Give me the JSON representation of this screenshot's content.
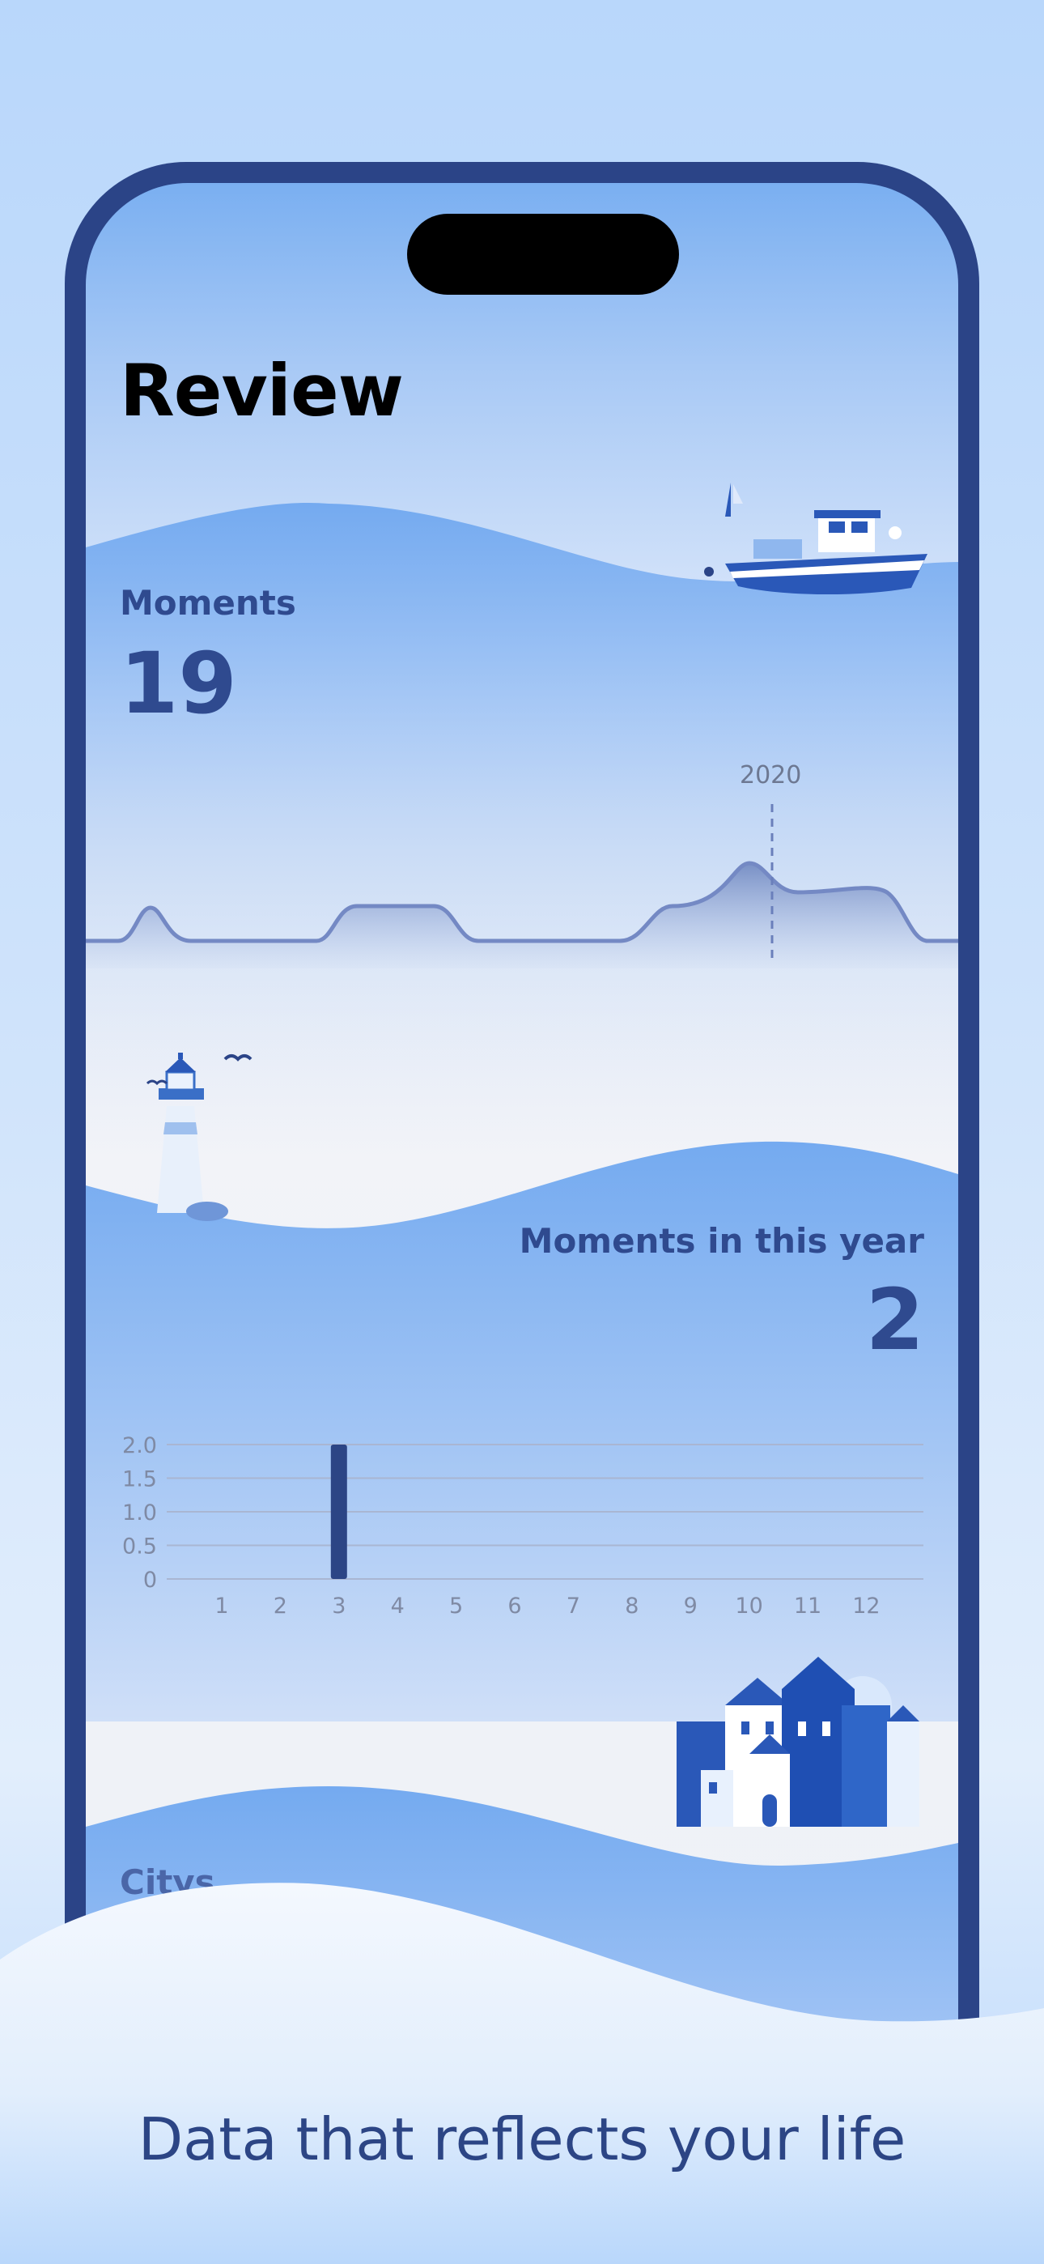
{
  "page": {
    "title": "Review",
    "tagline": "Data that reflects your life"
  },
  "moments": {
    "label": "Moments",
    "value": "19",
    "highlight_year": "2020"
  },
  "year_section": {
    "label": "Moments in this year",
    "value": "2"
  },
  "city_section": {
    "label": "Citys"
  },
  "chart_data": {
    "type": "bar",
    "categories": [
      "1",
      "2",
      "3",
      "4",
      "5",
      "6",
      "7",
      "8",
      "9",
      "10",
      "11",
      "12"
    ],
    "values": [
      0,
      0,
      2,
      0,
      0,
      0,
      0,
      0,
      0,
      0,
      0,
      0
    ],
    "y_ticks": [
      "2.0",
      "1.5",
      "1.0",
      "0.5",
      "0"
    ],
    "ylim": [
      0,
      2
    ],
    "grid": true
  },
  "colors": {
    "accent": "#2f4a8f",
    "frame": "#2b4487",
    "wave": "#7aaff1",
    "bar": "#2c4585"
  },
  "icons": {
    "boat": "fishing-boat-illustration",
    "lighthouse": "lighthouse-illustration",
    "town": "town-illustration"
  }
}
